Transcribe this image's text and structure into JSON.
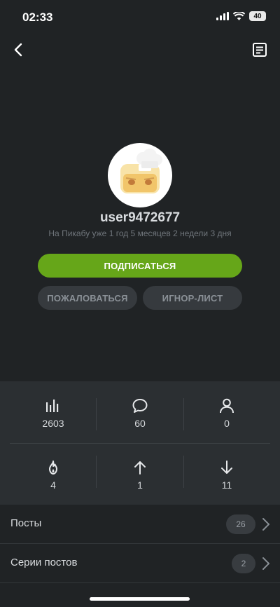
{
  "status_bar": {
    "time": "02:33",
    "battery": "40"
  },
  "profile": {
    "username": "user9472677",
    "member_since": "На Пикабу уже 1 год 5 месяцев 2 недели 3 дня"
  },
  "actions": {
    "subscribe_label": "ПОДПИСАТЬСЯ",
    "report_label": "ПОЖАЛОВАТЬСЯ",
    "ignore_label": "ИГНОР-ЛИСТ"
  },
  "stats": {
    "rating": "2603",
    "comments": "60",
    "subscribers": "0",
    "hot": "4",
    "pluses": "1",
    "minuses": "11"
  },
  "sections": [
    {
      "label": "Посты",
      "count": "26"
    },
    {
      "label": "Серии постов",
      "count": "2"
    }
  ],
  "colors": {
    "accent": "#66a619",
    "background": "#202325",
    "panel": "#2b2f32"
  }
}
